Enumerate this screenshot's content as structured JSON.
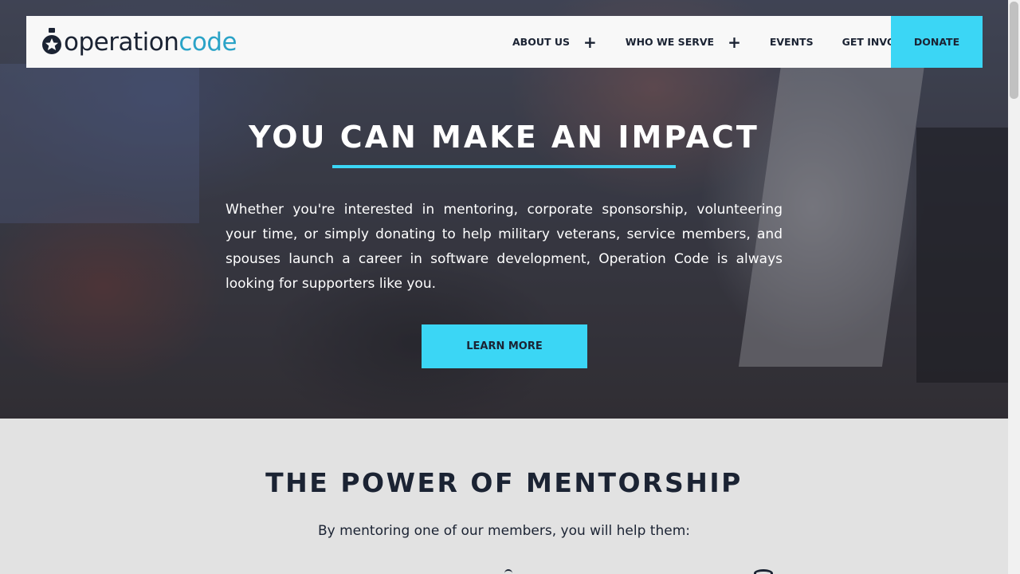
{
  "nav": {
    "logo": {
      "prefix": "operation",
      "suffix": "code"
    },
    "items": [
      {
        "label": "ABOUT US",
        "has_submenu": true
      },
      {
        "label": "WHO WE SERVE",
        "has_submenu": true
      },
      {
        "label": "EVENTS",
        "has_submenu": false
      },
      {
        "label": "GET INVOLVED",
        "has_submenu": true
      }
    ],
    "plus_icon": "+",
    "donate_label": "DONATE"
  },
  "hero": {
    "title": "YOU CAN MAKE AN IMPACT",
    "text": "Whether you're interested in mentoring, corporate sponsorship, volunteering your time, or simply donating to help military veterans, service members, and spouses launch a career in software development, Operation Code is always looking for supporters like you.",
    "cta_label": "LEARN MORE"
  },
  "mentorship": {
    "title": "THE POWER OF MENTORSHIP",
    "intro": "By mentoring one of our members, you will help them:"
  },
  "colors": {
    "accent": "#3bd6f5",
    "navy": "#1b2333",
    "logo_blue": "#2aa3c7",
    "section_bg": "#e2e2e2"
  }
}
